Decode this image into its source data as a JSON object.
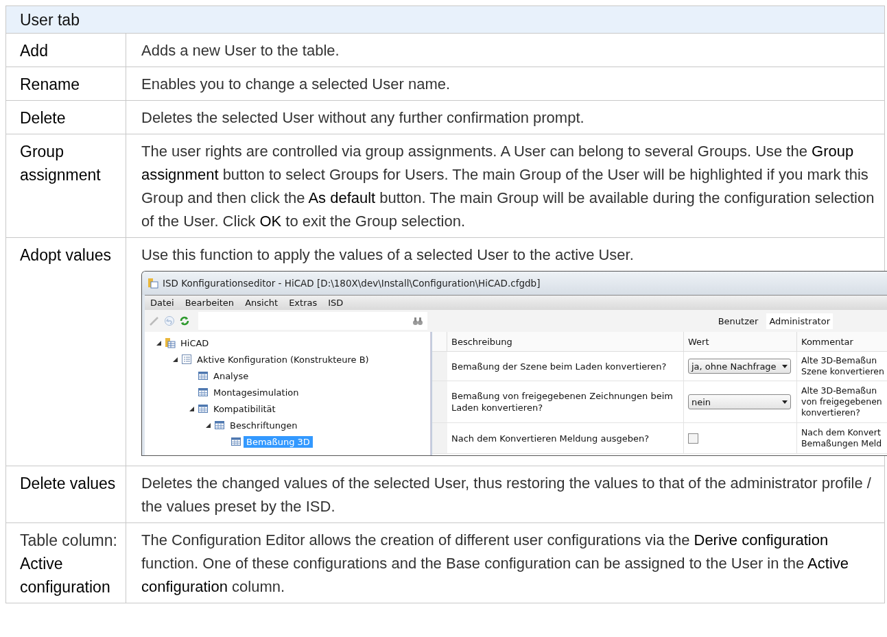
{
  "table": {
    "header": "User tab",
    "rows": [
      {
        "label": "Add",
        "description": "Adds a new User to the table."
      },
      {
        "label": "Rename",
        "description": "Enables you to change a selected User name."
      },
      {
        "label": "Delete",
        "description": "Deletes the selected User without any further confirmation prompt."
      },
      {
        "label": "Group assignment",
        "description": "The user rights are controlled via group assignments. A User can belong to several Groups. Use the **Group assignment** button to select Groups for Users. The main Group of the User will be highlighted if you mark this Group and then click the **As default** button. The main Group will be available during the configuration selection of the User. Click **OK** to exit the Group selection."
      },
      {
        "label": "Adopt values",
        "description": "Use this function to apply the values of a selected User to the active User.",
        "screenshot": {
          "title": "ISD Konfigurationseditor  - HiCAD [D:\\180X\\dev\\Install\\Configuration\\HiCAD.cfgdb]",
          "menu": [
            "Datei",
            "Bearbeiten",
            "Ansicht",
            "Extras",
            "ISD"
          ],
          "user_label": "Benutzer",
          "user_value": "Administrator",
          "tree": [
            {
              "label": "HiCAD",
              "kind": "root",
              "selected": false,
              "expanded": true,
              "children": [
                {
                  "label": "Aktive Konfiguration (Konstrukteure B)",
                  "kind": "list",
                  "selected": false,
                  "expanded": true,
                  "children": [
                    {
                      "label": "Analyse",
                      "kind": "table",
                      "selected": false
                    },
                    {
                      "label": "Montagesimulation",
                      "kind": "table",
                      "selected": false
                    },
                    {
                      "label": "Kompatibilität",
                      "kind": "table",
                      "selected": false,
                      "expanded": true,
                      "children": [
                        {
                          "label": "Beschriftungen",
                          "kind": "table",
                          "selected": false,
                          "expanded": true,
                          "children": [
                            {
                              "label": "Bemaßung 3D",
                              "kind": "table",
                              "selected": true
                            }
                          ]
                        }
                      ]
                    }
                  ]
                }
              ]
            }
          ],
          "columns": [
            "Beschreibung",
            "Wert",
            "Kommentar"
          ],
          "rows": [
            {
              "description": "Bemaßung der Szene beim Laden konvertieren?",
              "kind": "dropdown",
              "value": "ja, ohne Nachfrage",
              "comment": [
                "Alte 3D-Bemaßun",
                "Szene konvertieren"
              ]
            },
            {
              "description": "Bemaßung von freigegebenen Zeichnungen beim Laden konvertieren?",
              "kind": "dropdown",
              "value": "nein",
              "comment": [
                "Alte 3D-Bemaßun",
                "von freigegebenen",
                "konvertieren?"
              ]
            },
            {
              "description": "Nach dem Konvertieren Meldung ausgeben?",
              "kind": "checkbox",
              "checked": false,
              "comment": [
                "Nach dem Konvert",
                "Bemaßungen Meld"
              ]
            }
          ]
        }
      },
      {
        "label": "Delete values",
        "description": "Deletes the changed values of the selected User, thus restoring the values to that of the administrator profile / the values preset by the ISD."
      },
      {
        "label_prefix": "Table column:",
        "label": "Active configuration",
        "description": "The Configuration Editor allows the creation of different user configurations via the **Derive configuration** function. One of these configurations and the Base configuration can be assigned to the User in the **Active configuration** column."
      }
    ]
  }
}
